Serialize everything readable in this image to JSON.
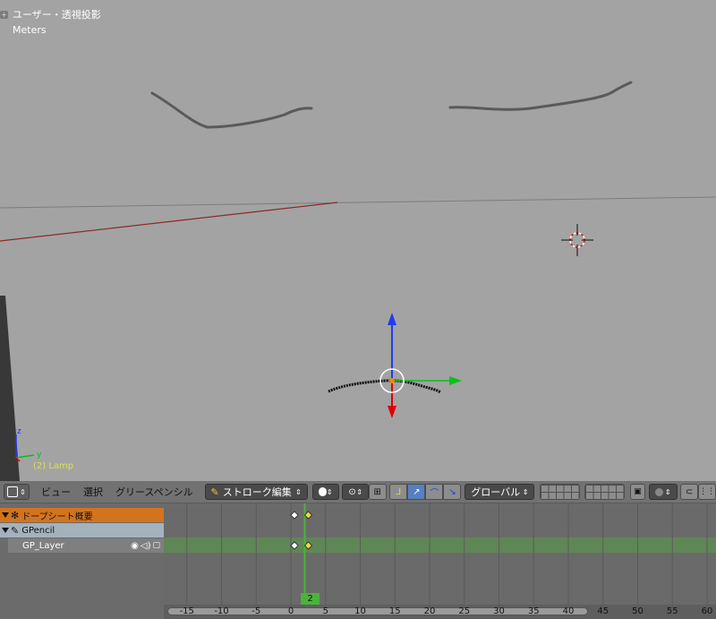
{
  "viewport": {
    "title": "ユーザー・透視投影",
    "units": "Meters",
    "active_object": "(2) Lamp",
    "axis_label_y": "y",
    "axis_label_z": "z",
    "manipulator_colors": {
      "x": "#00c21f",
      "y": "#1f3cf2",
      "z": "#e00000"
    }
  },
  "header": {
    "editor_type_icon": "dopesheet-icon",
    "menus": [
      "ビュー",
      "選択",
      "グリースペンシル"
    ],
    "mode_label": "ストローク編集",
    "pivot_icon": "circle-icon",
    "orientation_label": "グローバル"
  },
  "channels": {
    "summary": "ドープシート概要",
    "object": "GPencil",
    "layer": "GP_Layer"
  },
  "timeline": {
    "current_frame": "2",
    "ticks": [
      "-15",
      "-10",
      "-5",
      "0",
      "5",
      "10",
      "15",
      "20",
      "25",
      "30",
      "35",
      "40",
      "45",
      "50",
      "55",
      "60"
    ],
    "keyframes": [
      0,
      2
    ]
  },
  "colors": {
    "summary_bg": "#d2741e",
    "object_bg": "#a4b2bd",
    "active_row": "#5e8a55",
    "current_frame": "#4bb33a"
  }
}
